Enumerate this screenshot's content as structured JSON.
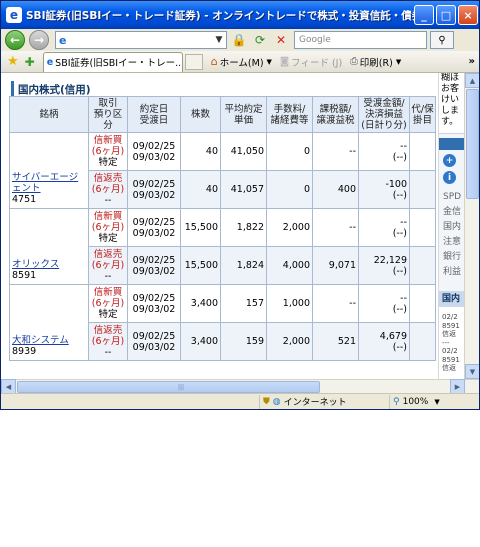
{
  "window": {
    "title": "SBI証券(旧SBIイー・トレード証券) - オンライントレードで株式・投資信託・債券を - Windo...",
    "app_icon": "ie-icon",
    "minimize": "_",
    "maximize": "□",
    "close": "×"
  },
  "address": {
    "url": "",
    "search_placeholder": "Google"
  },
  "tabs": {
    "active": "SBI証券(旧SBIイー・トレー...",
    "home": "ホーム(M)",
    "feed": "フィード (J)",
    "print": "印刷(R)",
    "more": "»"
  },
  "section": {
    "title": "国内株式(信用)"
  },
  "table": {
    "headers": {
      "name": "銘柄",
      "kubun": "取引\n預り区分",
      "dates": "約定日\n受渡日",
      "qty": "株数",
      "price": "平均約定\n単価",
      "fee": "手数料/\n諸経費等",
      "tax": "課税額/\n譲渡益税",
      "settle": "受渡金額/\n決済損益\n(日計り分)",
      "agent": "代/保\n掛目"
    },
    "groups": [
      {
        "name": "サイバーエージェント",
        "code": "4751",
        "rows": [
          {
            "kind": "信新買(6ヶ月)",
            "acct": "特定",
            "date1": "09/02/25",
            "date2": "09/03/02",
            "qty": "40",
            "price": "41,050",
            "fee": "0",
            "tax": "--",
            "settle1": "--",
            "settle2": "(--)",
            "agent": ""
          },
          {
            "kind": "信返売(6ヶ月)",
            "acct": "--",
            "date1": "09/02/25",
            "date2": "09/03/02",
            "qty": "40",
            "price": "41,057",
            "fee": "0",
            "tax": "400",
            "settle1": "-100",
            "settle2": "(--)",
            "agent": ""
          }
        ]
      },
      {
        "name": "オリックス",
        "code": "8591",
        "rows": [
          {
            "kind": "信新買(6ヶ月)",
            "acct": "特定",
            "date1": "09/02/25",
            "date2": "09/03/02",
            "qty": "15,500",
            "price": "1,822",
            "fee": "2,000",
            "tax": "--",
            "settle1": "--",
            "settle2": "(--)",
            "agent": ""
          },
          {
            "kind": "信返売(6ヶ月)",
            "acct": "--",
            "date1": "09/02/25",
            "date2": "09/03/02",
            "qty": "15,500",
            "price": "1,824",
            "fee": "4,000",
            "tax": "9,071",
            "settle1": "22,129",
            "settle2": "(--)",
            "agent": ""
          }
        ]
      },
      {
        "name": "大和システム",
        "code": "8939",
        "rows": [
          {
            "kind": "信新買(6ヶ月)",
            "acct": "特定",
            "date1": "09/02/25",
            "date2": "09/03/02",
            "qty": "3,400",
            "price": "157",
            "fee": "1,000",
            "tax": "--",
            "settle1": "--",
            "settle2": "(--)",
            "agent": ""
          },
          {
            "kind": "信返売(6ヶ月)",
            "acct": "--",
            "date1": "09/02/25",
            "date2": "09/03/02",
            "qty": "3,400",
            "price": "159",
            "fee": "2,000",
            "tax": "521",
            "settle1": "4,679",
            "settle2": "(--)",
            "agent": ""
          }
        ]
      }
    ]
  },
  "sidebar": {
    "top_text": "糊ほ\nお客\nけい\nしま\nす。",
    "list_text": "SPD\n金信\n国内\n注意\n銀行\n利益",
    "tab": "国内",
    "news": "02/2\n8591\n信返\n---\n02/2\n8591\n信返"
  },
  "status": {
    "zone": "インターネット",
    "zoom": "100%"
  }
}
